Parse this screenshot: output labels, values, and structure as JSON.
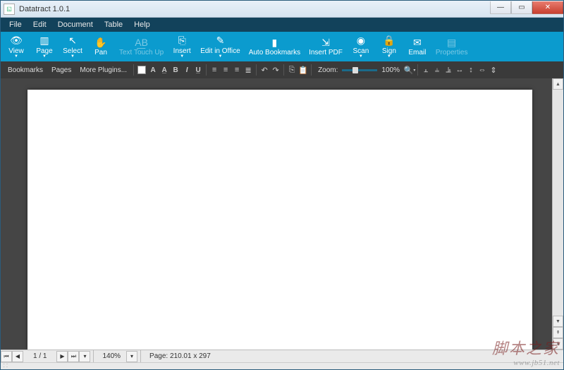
{
  "window": {
    "title": "Datatract 1.0.1"
  },
  "menubar": [
    "File",
    "Edit",
    "Document",
    "Table",
    "Help"
  ],
  "ribbon": [
    {
      "icon": "👁",
      "label": "View",
      "dd": true
    },
    {
      "icon": "▥",
      "label": "Page",
      "dd": true
    },
    {
      "icon": "↖",
      "label": "Select",
      "dd": true
    },
    {
      "icon": "✋",
      "label": "Pan"
    },
    {
      "icon": "A͟B",
      "label": "Text Touch Up",
      "disabled": true
    },
    {
      "icon": "⎘",
      "label": "Insert",
      "dd": true
    },
    {
      "icon": "✎",
      "label": "Edit in Office",
      "dd": true
    },
    {
      "icon": "▮",
      "label": "Auto Bookmarks"
    },
    {
      "icon": "⇲",
      "label": "Insert PDF"
    },
    {
      "icon": "◉",
      "label": "Scan",
      "dd": true
    },
    {
      "icon": "🔒",
      "label": "Sign",
      "dd": true
    },
    {
      "icon": "✉",
      "label": "Email"
    },
    {
      "icon": "▤",
      "label": "Properties",
      "disabled": true
    }
  ],
  "toolbar": {
    "tabs": [
      "Bookmarks",
      "Pages",
      "More Plugins..."
    ],
    "zoom_label": "Zoom:",
    "zoom_value": "100%"
  },
  "status": {
    "page": "1 / 1",
    "zoom": "140%",
    "page_size": "Page: 210.01 x 297"
  },
  "watermark": {
    "cn": "脚本之家",
    "url": "www.jb51.net"
  }
}
